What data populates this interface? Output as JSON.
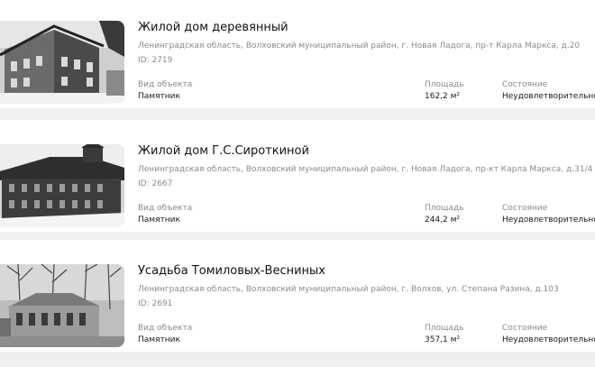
{
  "labels": {
    "type": "Вид объекта",
    "area": "Площадь",
    "state": "Состояние"
  },
  "items": [
    {
      "title": "Жилой дом деревянный",
      "address": "Ленинградская область, Волховский муниципальный район, г. Новая Ладога, пр-т Карла Маркса, д.20",
      "id": "ID: 2719",
      "type": "Памятник",
      "area": "162,2 м²",
      "state": "Неудовлетворительное"
    },
    {
      "title": "Жилой дом Г.С.Сироткиной",
      "address": "Ленинградская область, Волховский муниципальный район, г. Новая Ладога, пр-кт Карла Маркса, д.31/4",
      "id": "ID: 2667",
      "type": "Памятник",
      "area": "244,2 м²",
      "state": "Неудовлетворительное"
    },
    {
      "title": "Усадьба Томиловых-Весниных",
      "address": "Ленинградская область, Волховский муниципальный район, г. Волхов, ул. Степана Разина, д.103",
      "id": "ID: 2691",
      "type": "Памятник",
      "area": "357,1 м²",
      "state": "Неудовлетворительное"
    }
  ]
}
